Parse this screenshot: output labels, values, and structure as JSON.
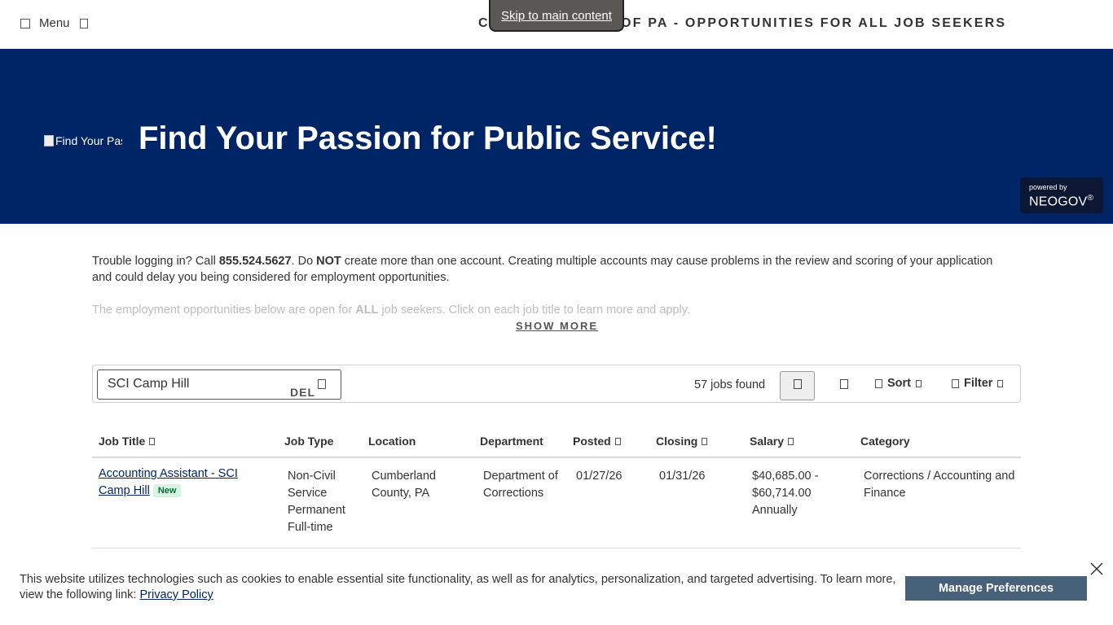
{
  "topbar": {
    "menu_label": "Menu",
    "site_title": "COMMONWEALTH OF PA - OPPORTUNITIES FOR ALL JOB SEEKERS",
    "skip_link": "Skip to main content"
  },
  "hero": {
    "logo_alt": "Find Your Passion",
    "title": "Find Your Passion for Public Service!",
    "powered_by": "powered by",
    "brand": "NEOGOV",
    "brand_mark": "®",
    "bg_color": "#002566"
  },
  "intro": {
    "line1_pre": "Trouble logging in? Call ",
    "phone": "855.524.5627",
    "line1_mid": ". Do ",
    "not": "NOT",
    "line1_post": " create more than one account.  Creating multiple accounts may cause problems in the review and scoring of your application and could delay you being considered for employment opportunities.",
    "faded_pre": "The employment opportunities below are open for ",
    "faded_bold": "ALL",
    "faded_post": " job seekers. Click on each job title to learn more and apply.",
    "show_more": "SHOW MORE"
  },
  "toolbar": {
    "search_value": "SCI Camp Hill",
    "del_tag": "DEL",
    "jobs_found": "57 jobs found",
    "sort_label": "Sort",
    "filter_label": "Filter",
    "icons": [
      "list-view-icon",
      "card-view-icon",
      "sort-icon",
      "filter-icon",
      "clear-search-icon"
    ]
  },
  "table": {
    "headers": [
      "Job Title",
      "Job Type",
      "Location",
      "Department",
      "Posted",
      "Closing",
      "Salary",
      "Category"
    ],
    "rows": [
      {
        "title": "Accounting Assistant - SCI Camp Hill",
        "badge": "New",
        "job_type": "Non-Civil Service Permanent Full-time",
        "location": "Cumberland County, PA",
        "department": "Department of Corrections",
        "posted": "01/27/26",
        "closing": "01/31/26",
        "salary": "$40,685.00 - $60,714.00 Annually",
        "category": "Corrections / Accounting and Finance"
      }
    ]
  },
  "cookie": {
    "text": "This website utilizes technologies such as cookies to enable essential site functionality, as well as for analytics, personalization, and targeted advertising. To learn more, view the following link: ",
    "link": "Privacy Policy",
    "button": "Manage Preferences",
    "button_color": "#466179"
  }
}
